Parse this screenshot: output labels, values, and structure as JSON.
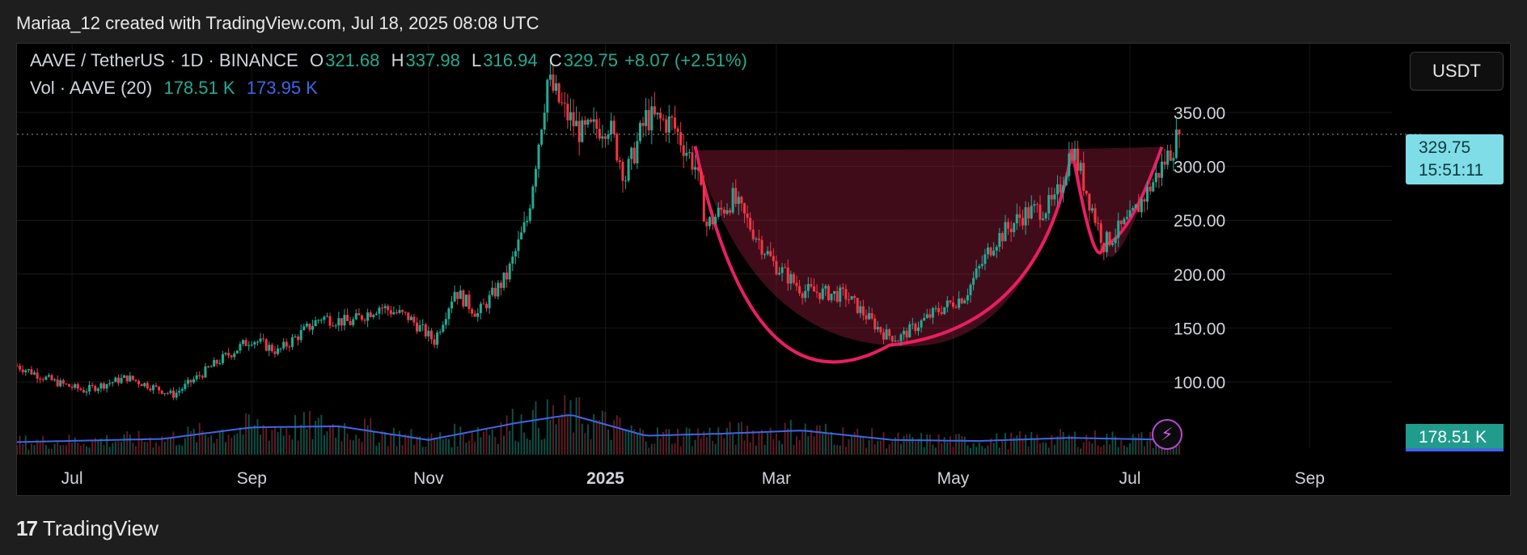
{
  "header": {
    "attribution": "Mariaa_12 created with TradingView.com, Jul 18, 2025 08:08 UTC"
  },
  "legend": {
    "symbol": "AAVE / TetherUS · 1D · BINANCE",
    "open_label": "O",
    "open": "321.68",
    "high_label": "H",
    "high": "337.98",
    "low_label": "L",
    "low": "316.94",
    "close_label": "C",
    "close": "329.75",
    "change": "+8.07 (+2.51%)",
    "vol_label": "Vol · AAVE (20)",
    "vol_value": "178.51 K",
    "vol_ma": "173.95 K"
  },
  "currency_button": "USDT",
  "price_tag": {
    "price": "329.75",
    "countdown": "15:51:11"
  },
  "volume_tag": "178.51 K",
  "footer": {
    "brand": "TradingView",
    "logo_mark": "17"
  },
  "colors": {
    "up": "#22ab94",
    "down": "#f23645",
    "volume_ma": "#3e66e6",
    "pattern": "#e91e63",
    "pattern_fill": "#8e1a3a",
    "background": "#000000"
  },
  "icons": {
    "flash": "lightning-icon"
  },
  "chart_data": {
    "type": "candlestick",
    "symbol": "AAVE/USDT",
    "timeframe": "1D",
    "x_ticks": [
      "Jul",
      "Sep",
      "Nov",
      "2025",
      "Mar",
      "May",
      "Jul",
      "Sep"
    ],
    "y_ticks": [
      100,
      150,
      200,
      250,
      300,
      350
    ],
    "y_range": [
      60,
      395
    ],
    "last_price": 329.75,
    "price_anchors": [
      [
        "2024-06-12",
        115
      ],
      [
        "2024-06-25",
        100
      ],
      [
        "2024-07-05",
        92
      ],
      [
        "2024-07-20",
        104
      ],
      [
        "2024-08-05",
        88
      ],
      [
        "2024-08-20",
        118
      ],
      [
        "2024-09-01",
        140
      ],
      [
        "2024-09-10",
        128
      ],
      [
        "2024-09-25",
        160
      ],
      [
        "2024-10-05",
        155
      ],
      [
        "2024-10-15",
        170
      ],
      [
        "2024-10-25",
        160
      ],
      [
        "2024-11-03",
        138
      ],
      [
        "2024-11-10",
        185
      ],
      [
        "2024-11-18",
        163
      ],
      [
        "2024-11-28",
        198
      ],
      [
        "2024-12-05",
        250
      ],
      [
        "2024-12-12",
        380
      ],
      [
        "2024-12-18",
        350
      ],
      [
        "2024-12-24",
        330
      ],
      [
        "2025-01-02",
        340
      ],
      [
        "2025-01-08",
        290
      ],
      [
        "2025-01-15",
        345
      ],
      [
        "2025-01-24",
        340
      ],
      [
        "2025-02-01",
        300
      ],
      [
        "2025-02-05",
        245
      ],
      [
        "2025-02-14",
        270
      ],
      [
        "2025-02-28",
        210
      ],
      [
        "2025-03-10",
        185
      ],
      [
        "2025-03-25",
        180
      ],
      [
        "2025-04-07",
        145
      ],
      [
        "2025-04-12",
        140
      ],
      [
        "2025-04-25",
        165
      ],
      [
        "2025-05-05",
        180
      ],
      [
        "2025-05-15",
        230
      ],
      [
        "2025-05-25",
        255
      ],
      [
        "2025-06-05",
        265
      ],
      [
        "2025-06-11",
        318
      ],
      [
        "2025-06-22",
        228
      ],
      [
        "2025-07-01",
        250
      ],
      [
        "2025-07-10",
        290
      ],
      [
        "2025-07-18",
        329.75
      ]
    ],
    "volume_ma_anchors": [
      [
        "2024-06-12",
        12
      ],
      [
        "2024-08-01",
        15
      ],
      [
        "2024-09-01",
        26
      ],
      [
        "2024-10-01",
        27
      ],
      [
        "2024-11-01",
        14
      ],
      [
        "2024-12-01",
        30
      ],
      [
        "2024-12-20",
        38
      ],
      [
        "2025-01-15",
        18
      ],
      [
        "2025-02-10",
        20
      ],
      [
        "2025-03-10",
        23
      ],
      [
        "2025-04-10",
        14
      ],
      [
        "2025-05-10",
        13
      ],
      [
        "2025-06-10",
        16
      ],
      [
        "2025-07-18",
        14
      ]
    ],
    "pattern": "cup and handle",
    "cup": {
      "rim_left": [
        "2025-02-01",
        315
      ],
      "bottom": [
        "2025-04-09",
        134
      ],
      "rim_right": [
        "2025-06-11",
        316
      ]
    },
    "handle": {
      "start": [
        "2025-06-11",
        316
      ],
      "bottom": [
        "2025-06-22",
        227
      ],
      "end": [
        "2025-07-12",
        318
      ]
    },
    "grid": true
  }
}
